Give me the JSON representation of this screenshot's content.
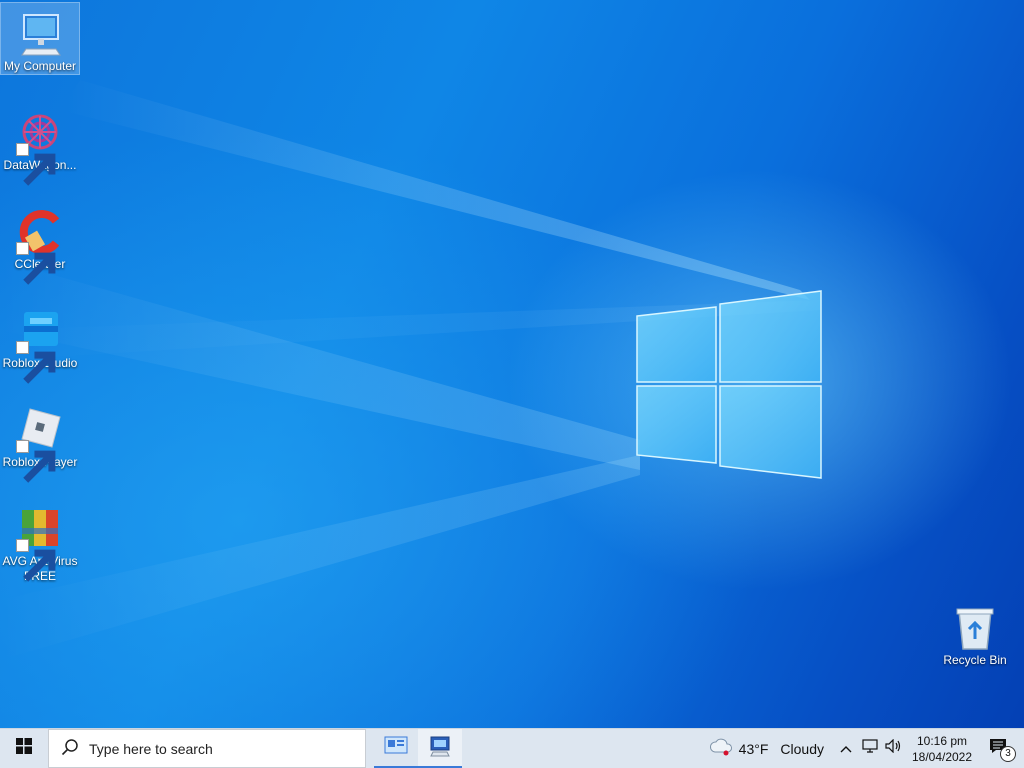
{
  "desktop": {
    "icons": [
      {
        "label": "My Computer",
        "icon": "computer-monitor-icon"
      },
      {
        "label": "DataWagon...",
        "icon": "datawagon-icon"
      },
      {
        "label": "CCleaner",
        "icon": "ccleaner-icon"
      },
      {
        "label": "Roblox Studio",
        "icon": "roblox-studio-icon"
      },
      {
        "label": "Roblox Player",
        "icon": "roblox-player-icon"
      },
      {
        "label": "AVG AntiVirus FREE",
        "icon": "avg-antivirus-icon"
      }
    ],
    "recycle_bin": {
      "label": "Recycle Bin",
      "icon": "recycle-bin-icon"
    }
  },
  "taskbar": {
    "start_icon": "windows-logo-icon",
    "search": {
      "placeholder": "Type here to search",
      "icon": "search-icon"
    },
    "apps": [
      {
        "icon": "control-panel-icon",
        "active": false
      },
      {
        "icon": "system-properties-icon",
        "active": true
      }
    ],
    "tray": {
      "weather": {
        "temperature": "43°F",
        "condition": "Cloudy",
        "icon": "cloudy-weather-icon"
      },
      "icons": [
        "chevron-up-icon",
        "network-icon",
        "volume-icon"
      ],
      "clock": {
        "time": "10:16 pm",
        "date": "18/04/2022"
      },
      "notifications": {
        "count": "3",
        "icon": "notification-icon"
      }
    }
  },
  "colors": {
    "accent": "#0a64d6",
    "taskbar": "#dde6f0"
  }
}
